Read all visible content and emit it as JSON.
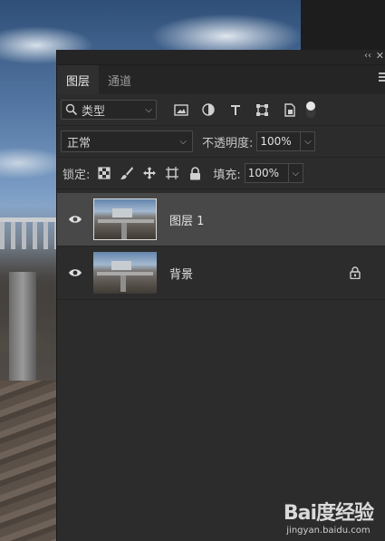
{
  "panel": {
    "collapse_glyph": "‹‹",
    "close_glyph": "✕",
    "tabs": [
      {
        "label": "图层",
        "active": true
      },
      {
        "label": "通道",
        "active": false
      }
    ]
  },
  "filter": {
    "kind_label": "类型",
    "icons": [
      "image-filter-icon",
      "adjustment-filter-icon",
      "type-filter-icon",
      "shape-filter-icon",
      "smart-object-filter-icon"
    ]
  },
  "blend": {
    "mode": "正常",
    "opacity_label": "不透明度:",
    "opacity_value": "100%"
  },
  "lock": {
    "label": "锁定:",
    "fill_label": "填充:",
    "fill_value": "100%"
  },
  "layers": [
    {
      "name": "图层 1",
      "selected": true,
      "locked": false
    },
    {
      "name": "背景",
      "selected": false,
      "locked": true
    }
  ],
  "watermark": {
    "logo": "Bai度经验",
    "sub": "jingyan.baidu.com"
  },
  "colors": {
    "panel_bg": "#2c2c2c",
    "selected_row": "#484848",
    "tab_bar": "#252525"
  }
}
